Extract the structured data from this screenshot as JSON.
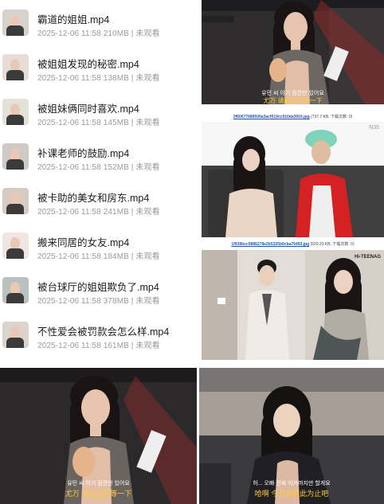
{
  "file_list": {
    "items": [
      {
        "title": "霸道的姐姐.mp4",
        "date": "2025-12-06 11:58",
        "size": "210MB",
        "status": "未观看",
        "thumb_bg": "#d8d2cc"
      },
      {
        "title": "被姐姐发现的秘密.mp4",
        "date": "2025-12-06 11:58",
        "size": "138MB",
        "status": "未观看",
        "thumb_bg": "#e7ddd6"
      },
      {
        "title": "被姐妹俩同时喜欢.mp4",
        "date": "2025-12-06 11:58",
        "size": "145MB",
        "status": "未观看",
        "thumb_bg": "#e4e1d8"
      },
      {
        "title": "补课老师的鼓励.mp4",
        "date": "2025-12-06 11:58",
        "size": "152MB",
        "status": "未观看",
        "thumb_bg": "#cfcac4"
      },
      {
        "title": "被卡助的美女和房东.mp4",
        "date": "2025-12-06 11:58",
        "size": "241MB",
        "status": "未观看",
        "thumb_bg": "#d7cbc4"
      },
      {
        "title": "搬来同居的女友.mp4",
        "date": "2025-12-06 11:58",
        "size": "184MB",
        "status": "未观看",
        "thumb_bg": "#efe6e2"
      },
      {
        "title": "被台球厅的姐姐欺负了.mp4",
        "date": "2025-12-06 11:58",
        "size": "378MB",
        "status": "未观看",
        "thumb_bg": "#b9c2bd"
      },
      {
        "title": "不性爱会被罚款会怎么样.mp4",
        "date": "2025-12-06 11:58",
        "size": "161MB",
        "status": "未观看",
        "thumb_bg": "#dcd4cc"
      }
    ]
  },
  "image_grid": {
    "frame1": {
      "sub_ko": "유민 씨 이기 잠깐만 있어요",
      "sub_zh": "尤万 请在这里等一下"
    },
    "caption1": {
      "name": "2f60677689500a3acf019cc910da3916.jpg",
      "info": "(737.7 KB, 下载次数: 0)"
    },
    "frame2": {
      "logo": "N35"
    },
    "caption2": {
      "name": "1f939bcc5886278e2b5325b0cba76493.jpg",
      "info": "(529.23 KB, 下载次数: 0)"
    },
    "frame3": {
      "logo": "Hi-TEENAG"
    }
  },
  "bottom_row": {
    "left": {
      "sub_ko": "유민 씨 이기 잠깐만 있어요",
      "sub_zh": "尤万 请在这里等一下"
    },
    "right": {
      "sub_ko": "하... 오빠 진짜 이거까지만 할게요",
      "sub_zh": "哈啊 今天就到此为止吧"
    }
  }
}
